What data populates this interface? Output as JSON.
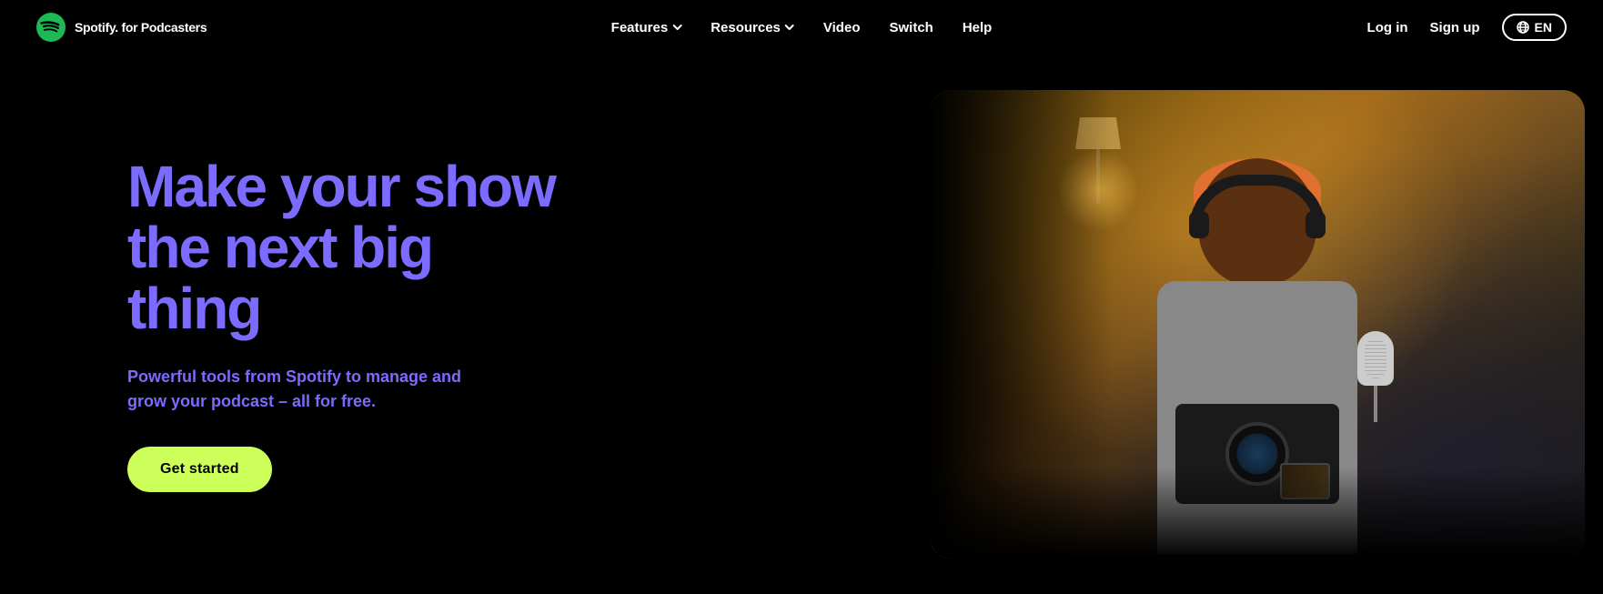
{
  "brand": {
    "logo_text": "Spotify. for Podcasters"
  },
  "nav": {
    "center_items": [
      {
        "label": "Features",
        "has_dropdown": true
      },
      {
        "label": "Resources",
        "has_dropdown": true
      },
      {
        "label": "Video",
        "has_dropdown": false
      },
      {
        "label": "Switch",
        "has_dropdown": false
      },
      {
        "label": "Help",
        "has_dropdown": false
      }
    ],
    "right_items": [
      {
        "label": "Log in"
      },
      {
        "label": "Sign up"
      }
    ],
    "lang_button": "EN"
  },
  "hero": {
    "title_line1": "Make your show",
    "title_line2": "the next big thing",
    "subtitle": "Powerful tools from Spotify to manage and grow your podcast – all for free.",
    "cta_label": "Get started"
  }
}
